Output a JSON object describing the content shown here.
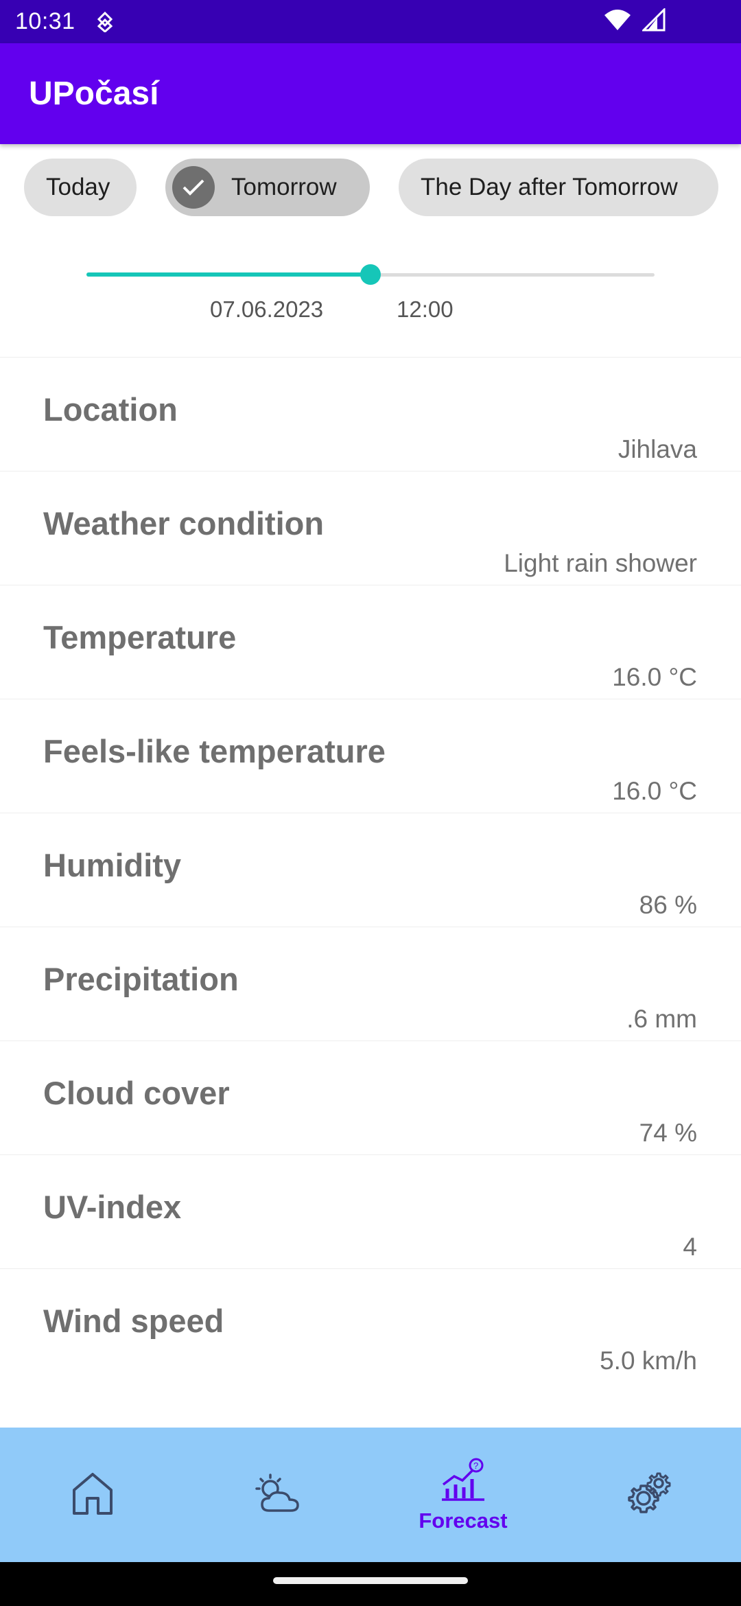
{
  "status_bar": {
    "time": "10:31"
  },
  "app_bar": {
    "title": "UPočasí"
  },
  "chips": [
    {
      "label": "Today",
      "selected": false
    },
    {
      "label": "Tomorrow",
      "selected": true
    },
    {
      "label": "The Day after Tomorrow",
      "selected": false
    }
  ],
  "slider": {
    "value": 0.5,
    "date": "07.06.2023",
    "time": "12:00"
  },
  "rows": [
    {
      "label": "Location",
      "value": "Jihlava"
    },
    {
      "label": "Weather condition",
      "value": "Light rain shower"
    },
    {
      "label": "Temperature",
      "value": "16.0 °C"
    },
    {
      "label": "Feels-like temperature",
      "value": "16.0 °C"
    },
    {
      "label": "Humidity",
      "value": "86 %"
    },
    {
      "label": "Precipitation",
      "value": ".6 mm"
    },
    {
      "label": "Cloud cover",
      "value": "74 %"
    },
    {
      "label": "UV-index",
      "value": "4"
    },
    {
      "label": "Wind speed",
      "value": "5.0 km/h"
    }
  ],
  "bottom_nav": {
    "items": [
      {
        "icon": "home-icon",
        "label": ""
      },
      {
        "icon": "partly-cloudy-icon",
        "label": ""
      },
      {
        "icon": "forecast-chart-icon",
        "label": "Forecast",
        "active": true
      },
      {
        "icon": "settings-gear-icon",
        "label": ""
      }
    ]
  },
  "colors": {
    "status_bar": "#3700b3",
    "app_bar": "#6200ee",
    "slider_accent": "#16c6b8",
    "bottom_nav": "#90caf9",
    "nav_active": "#6200ee"
  }
}
